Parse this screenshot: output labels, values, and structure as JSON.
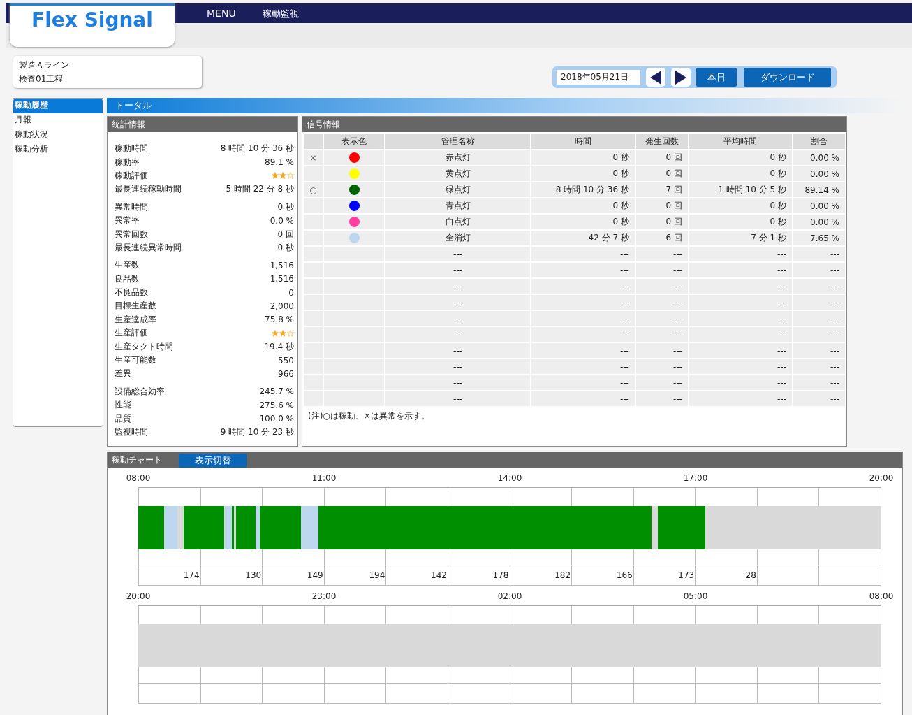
{
  "header": {
    "logo": "Flex Signal",
    "menu": [
      "MENU",
      "稼動監視"
    ]
  },
  "location": [
    "製造Ａライン",
    "検査01工程"
  ],
  "date_nav": {
    "date": "2018年05月21日",
    "today": "本日",
    "download": "ダウンロード"
  },
  "sidebar": {
    "items": [
      {
        "label": "稼動履歴",
        "selected": true
      },
      {
        "label": "月報",
        "selected": false
      },
      {
        "label": "稼動状況",
        "selected": false
      },
      {
        "label": "稼動分析",
        "selected": false
      }
    ]
  },
  "section_title": "トータル",
  "stats": {
    "title": "統計情報",
    "groups": [
      [
        {
          "kind": "text",
          "label": "稼動時間",
          "value": "8 時間 10 分 36 秒"
        },
        {
          "kind": "text",
          "label": "稼動率",
          "value": "89.1 %"
        },
        {
          "kind": "stars",
          "label": "稼動評価",
          "stars": 2
        },
        {
          "kind": "text",
          "label": "最長連続稼動時間",
          "value": "5 時間 22 分 8 秒"
        }
      ],
      [
        {
          "kind": "text",
          "label": "異常時間",
          "value": "0 秒"
        },
        {
          "kind": "text",
          "label": "異常率",
          "value": "0.0 %"
        },
        {
          "kind": "text",
          "label": "異常回数",
          "value": "0 回"
        },
        {
          "kind": "text",
          "label": "最長連続異常時間",
          "value": "0 秒"
        }
      ],
      [
        {
          "kind": "text",
          "label": "生産数",
          "value": "1,516"
        },
        {
          "kind": "text",
          "label": "良品数",
          "value": "1,516"
        },
        {
          "kind": "text",
          "label": "不良品数",
          "value": "0"
        },
        {
          "kind": "text",
          "label": "目標生産数",
          "value": "2,000"
        },
        {
          "kind": "text",
          "label": "生産達成率",
          "value": "75.8 %"
        },
        {
          "kind": "stars",
          "label": "生産評価",
          "stars": 2
        },
        {
          "kind": "text",
          "label": "生産タクト時間",
          "value": "19.4 秒"
        },
        {
          "kind": "text",
          "label": "生産可能数",
          "value": "550"
        },
        {
          "kind": "text",
          "label": "差異",
          "value": "966"
        }
      ],
      [
        {
          "kind": "text",
          "label": "設備総合効率",
          "value": "245.7 %"
        },
        {
          "kind": "text",
          "label": "性能",
          "value": "275.6 %"
        },
        {
          "kind": "text",
          "label": "品質",
          "value": "100.0 %"
        },
        {
          "kind": "text",
          "label": "監視時間",
          "value": "9 時間 10 分 23 秒"
        }
      ]
    ]
  },
  "signals": {
    "title": "信号情報",
    "columns": [
      "表示色",
      "管理名称",
      "時間",
      "発生回数",
      "平均時間",
      "割合"
    ],
    "rows": [
      {
        "mark": "×",
        "color": "#ff0000",
        "name": "赤点灯",
        "time": "0 秒",
        "count": "0 回",
        "average": "0 秒",
        "ratio": "0.00 %"
      },
      {
        "color": "#ffff00",
        "name": "黄点灯",
        "time": "0 秒",
        "count": "0 回",
        "average": "0 秒",
        "ratio": "0.00 %"
      },
      {
        "mark": "○",
        "color": "#006400",
        "name": "緑点灯",
        "time": "8 時間 10 分 36 秒",
        "count": "7 回",
        "average": "1 時間 10 分 5 秒",
        "ratio": "89.14 %"
      },
      {
        "color": "#0000ff",
        "name": "青点灯",
        "time": "0 秒",
        "count": "0 回",
        "average": "0 秒",
        "ratio": "0.00 %"
      },
      {
        "color": "#ff3fa0",
        "name": "白点灯",
        "time": "0 秒",
        "count": "0 回",
        "average": "0 秒",
        "ratio": "0.00 %"
      },
      {
        "color": "#bdd7ee",
        "name": "全消灯",
        "time": "42 分 7 秒",
        "count": "6 回",
        "average": "7 分 1 秒",
        "ratio": "7.65 %"
      },
      {
        "name": "---",
        "time": "---",
        "count": "---",
        "average": "---",
        "ratio": "---"
      },
      {
        "name": "---",
        "time": "---",
        "count": "---",
        "average": "---",
        "ratio": "---"
      },
      {
        "name": "---",
        "time": "---",
        "count": "---",
        "average": "---",
        "ratio": "---"
      },
      {
        "name": "---",
        "time": "---",
        "count": "---",
        "average": "---",
        "ratio": "---"
      },
      {
        "name": "---",
        "time": "---",
        "count": "---",
        "average": "---",
        "ratio": "---"
      },
      {
        "name": "---",
        "time": "---",
        "count": "---",
        "average": "---",
        "ratio": "---"
      },
      {
        "name": "---",
        "time": "---",
        "count": "---",
        "average": "---",
        "ratio": "---"
      },
      {
        "name": "---",
        "time": "---",
        "count": "---",
        "average": "---",
        "ratio": "---"
      },
      {
        "name": "---",
        "time": "---",
        "count": "---",
        "average": "---",
        "ratio": "---"
      },
      {
        "name": "---",
        "time": "---",
        "count": "---",
        "average": "---",
        "ratio": "---"
      }
    ],
    "note": "(注)○は稼動、×は異常を示す。"
  },
  "chart": {
    "title": "稼動チャート",
    "toggle": "表示切替",
    "timelines": [
      {
        "hour_labels": [
          "08:00",
          "11:00",
          "14:00",
          "17:00",
          "20:00"
        ],
        "hour_counts": [
          "174",
          "130",
          "149",
          "194",
          "142",
          "178",
          "182",
          "166",
          "173",
          "28"
        ]
      },
      {
        "hour_labels": [
          "20:00",
          "23:00",
          "02:00",
          "05:00",
          "08:00"
        ]
      }
    ]
  }
}
